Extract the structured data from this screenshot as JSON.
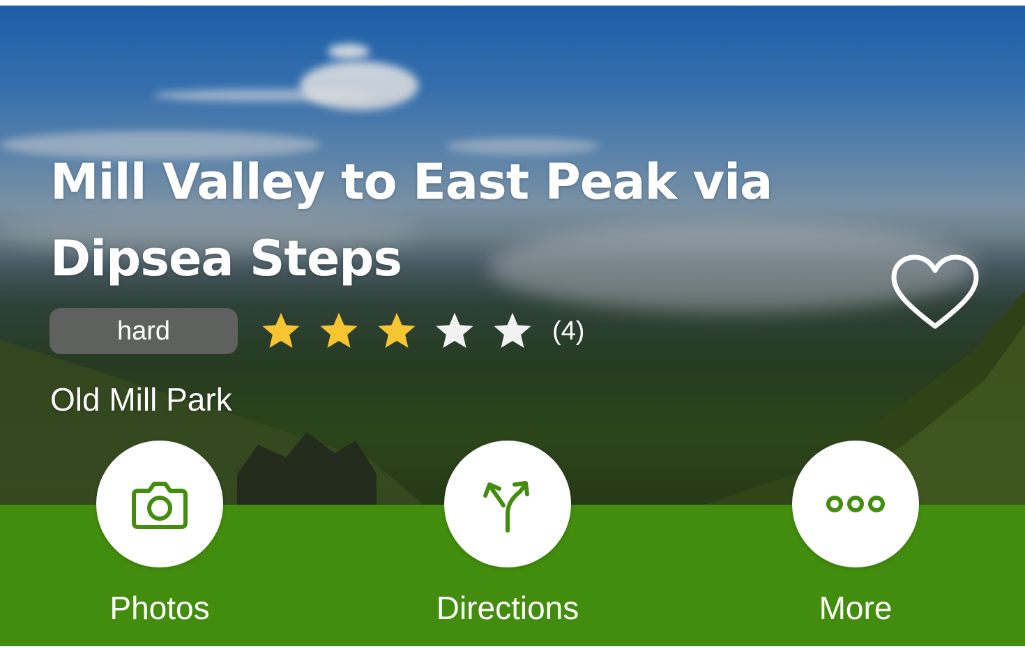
{
  "trail": {
    "title": "Mill Valley to East Peak via Dipsea Steps",
    "difficulty": "hard",
    "rating": {
      "value": 3,
      "max": 5,
      "count_label": "(4)"
    },
    "park": "Old Mill Park"
  },
  "favorite": {
    "icon": "heart-outline-icon"
  },
  "actions": [
    {
      "label": "Photos",
      "icon": "camera-icon"
    },
    {
      "label": "Directions",
      "icon": "directions-fork-icon"
    },
    {
      "label": "More",
      "icon": "ellipsis-icon"
    }
  ],
  "colors": {
    "accent_green": "#428d0d",
    "star_filled": "#f7c531",
    "star_empty": "#f2f2f2",
    "badge_background": "#646464"
  }
}
